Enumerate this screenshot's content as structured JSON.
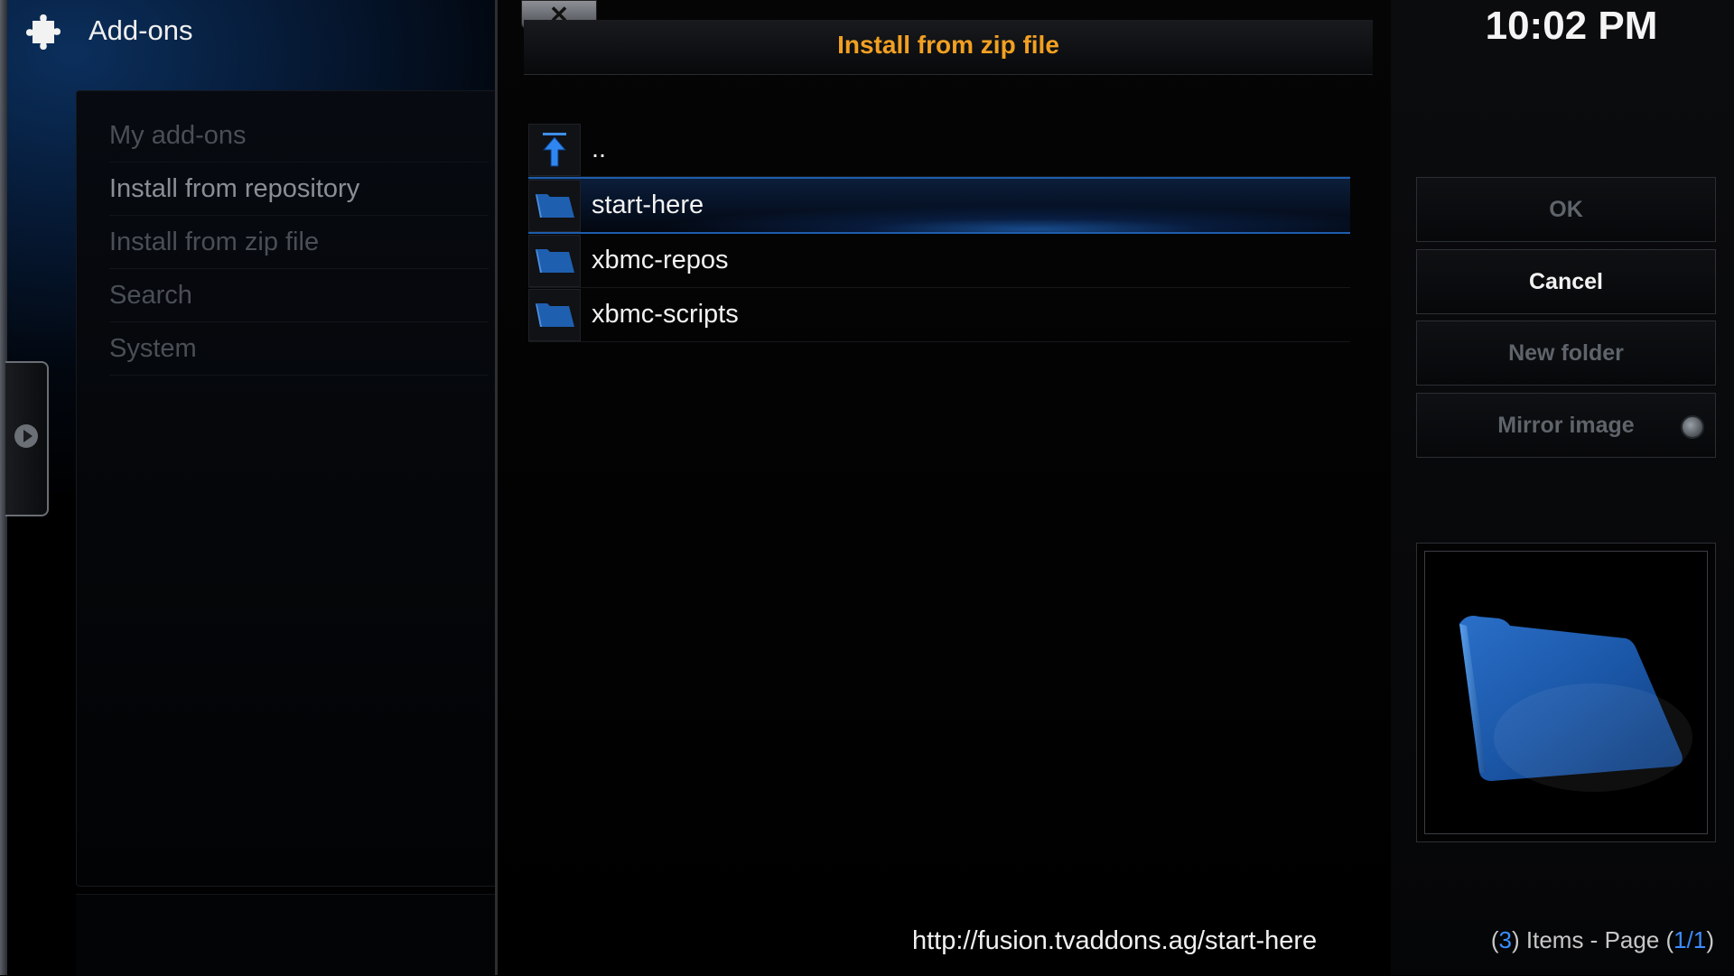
{
  "window": {
    "title": "Add-ons"
  },
  "menu": {
    "items": [
      {
        "label": "My add-ons",
        "focused": false
      },
      {
        "label": "Install from repository",
        "focused": true
      },
      {
        "label": "Install from zip file",
        "focused": false
      },
      {
        "label": "Search",
        "focused": false
      },
      {
        "label": "System",
        "focused": false
      }
    ]
  },
  "dialog": {
    "title": "Install from zip file",
    "close_label": "✕",
    "files": [
      {
        "label": "..",
        "icon": "parent-folder-arrow-icon"
      },
      {
        "label": "start-here",
        "icon": "folder-icon",
        "selected": true
      },
      {
        "label": "xbmc-repos",
        "icon": "folder-icon"
      },
      {
        "label": "xbmc-scripts",
        "icon": "folder-icon"
      }
    ],
    "current_path": "http://fusion.tvaddons.ag/start-here"
  },
  "clock": "10:02 PM",
  "buttons": {
    "ok": "OK",
    "cancel": "Cancel",
    "new_folder": "New folder",
    "mirror_image": "Mirror image"
  },
  "status": {
    "open_paren": "(",
    "items_count": "3",
    "items_mid": ") Items - Page (",
    "page": "1/1",
    "close_paren": ")"
  },
  "colors": {
    "title_accent": "#f2a022",
    "selection_blue": "#1e5dad",
    "number_accent": "#3a8dff"
  }
}
